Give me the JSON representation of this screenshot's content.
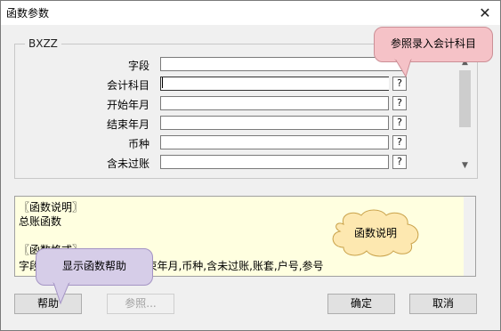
{
  "window": {
    "title": "函数参数",
    "close_glyph": "✕"
  },
  "group": {
    "title": "BXZZ"
  },
  "fields": [
    {
      "label": "字段",
      "value": "",
      "has_button": false
    },
    {
      "label": "会计科目",
      "value": "",
      "has_button": true
    },
    {
      "label": "开始年月",
      "value": "",
      "has_button": true
    },
    {
      "label": "结束年月",
      "value": "",
      "has_button": true
    },
    {
      "label": "币种",
      "value": "",
      "has_button": true
    },
    {
      "label": "含未过账",
      "value": "",
      "has_button": true
    }
  ],
  "field_button_label": "?",
  "description": {
    "lines": [
      "〖函数说明〗",
      "总账函数",
      "",
      "〖函数格式〗",
      "字段,会计科目,开始年月,结束年月,币种,含未过账,账套,户号,参号"
    ]
  },
  "buttons": {
    "help": "帮助",
    "reference": "参照...",
    "ok": "确定",
    "cancel": "取消"
  },
  "callouts": {
    "account_ref": "参照录入会计科目",
    "func_desc": "函数说明",
    "show_help": "显示函数帮助"
  },
  "colors": {
    "desc_bg": "#ffffe0",
    "callout_pink": "#f5c2c7",
    "callout_purple": "#d6cde8",
    "cloud": "#fde8b0"
  }
}
